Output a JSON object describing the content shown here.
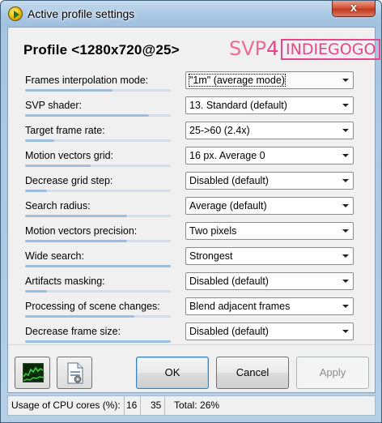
{
  "window": {
    "title": "Active profile settings",
    "close_glyph": "x"
  },
  "header": {
    "profile_title": "Profile <1280x720@25>",
    "logo": {
      "svp_text": "SVP",
      "svp_number": "4",
      "partner_text": "INDIEGOGO"
    }
  },
  "settings": [
    {
      "label": "Frames interpolation mode:",
      "value": "\"1m\" (average mode)",
      "level": 0.6,
      "focused": true
    },
    {
      "label": "SVP shader:",
      "value": "13. Standard (default)",
      "level": 0.85,
      "focused": false
    },
    {
      "label": "Target frame rate:",
      "value": "25->60 (2.4x)",
      "level": 0.2,
      "focused": false
    },
    {
      "label": "Motion vectors grid:",
      "value": "16 px. Average 0",
      "level": 0.45,
      "focused": false
    },
    {
      "label": "Decrease grid step:",
      "value": "Disabled (default)",
      "level": 0.15,
      "focused": false
    },
    {
      "label": "Search radius:",
      "value": "Average (default)",
      "level": 0.7,
      "focused": false
    },
    {
      "label": "Motion vectors precision:",
      "value": "Two pixels",
      "level": 0.7,
      "focused": false
    },
    {
      "label": "Wide search:",
      "value": "Strongest",
      "level": 1.0,
      "focused": false
    },
    {
      "label": "Artifacts masking:",
      "value": "Disabled (default)",
      "level": 0.15,
      "focused": false
    },
    {
      "label": "Processing of scene changes:",
      "value": "Blend adjacent frames",
      "level": 0.75,
      "focused": false
    },
    {
      "label": "Decrease frame size:",
      "value": "Disabled (default)",
      "level": 1.0,
      "focused": false
    }
  ],
  "buttons": {
    "graph_icon": "graph-icon",
    "file_icon": "file-settings-icon",
    "ok": "OK",
    "cancel": "Cancel",
    "apply": "Apply"
  },
  "status": {
    "cpu_label": "Usage of CPU cores (%):",
    "core1": "16",
    "core2": "35",
    "total": "Total: 26%"
  },
  "colors": {
    "accent_pink": "#e7468a",
    "graph_green": "#3fd33f",
    "level_bar": "#9fbedb"
  }
}
